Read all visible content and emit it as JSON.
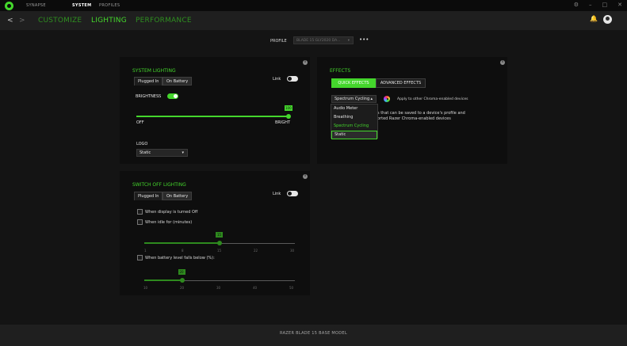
{
  "titlebar": {
    "tabs": [
      "SYNAPSE",
      "SYSTEM",
      "PROFILES"
    ],
    "active_tab": "SYSTEM"
  },
  "subnav": {
    "back": "<",
    "forward": ">",
    "tabs": [
      "CUSTOMIZE",
      "LIGHTING",
      "PERFORMANCE"
    ],
    "active_tab": "LIGHTING"
  },
  "profile": {
    "label": "PROFILE",
    "value": "BLADE 15 GLY2020 DA...",
    "more": "•••"
  },
  "system_lighting": {
    "title": "SYSTEM LIGHTING",
    "tabs": [
      "Plugged In",
      "On Battery"
    ],
    "link_label": "Link",
    "link_on": false,
    "brightness_label": "BRIGHTNESS",
    "brightness_toggle_on": true,
    "brightness_value": "100",
    "brightness_fraction": 1.0,
    "min_label": "OFF",
    "max_label": "BRIGHT",
    "logo_label": "LOGO",
    "logo_value": "Static"
  },
  "switch_off_lighting": {
    "title": "SWITCH OFF LIGHTING",
    "tabs": [
      "Plugged In",
      "On Battery"
    ],
    "link_label": "Link",
    "link_on": false,
    "opt_display_off": "When display is turned Off",
    "opt_idle": "When idle for (minutes)",
    "idle_value": "15",
    "idle_fraction": 0.5,
    "idle_ticks": [
      "1",
      "8",
      "15",
      "22",
      "30"
    ],
    "opt_battery": "When battery level falls below (%):",
    "battery_value": "20",
    "battery_fraction": 0.25,
    "battery_ticks": [
      "10",
      "20",
      "30",
      "40",
      "50"
    ]
  },
  "effects": {
    "title": "EFFECTS",
    "tabs": [
      "QUICK EFFECTS",
      "ADVANCED EFFECTS"
    ],
    "selected": "Spectrum Cycling",
    "apply_label": "Apply to other Chroma-enabled devices",
    "options": [
      "Audio Meter",
      "Breathing",
      "Spectrum Cycling",
      "Static"
    ],
    "highlighted": "Spectrum Cycling",
    "hovered": "Static",
    "desc_line1": "s that can be saved to a device's profile and",
    "desc_line2": "orted Razer Chroma-enabled devices"
  },
  "footer": {
    "device": "RAZER BLADE 15 BASE MODEL"
  },
  "colors": {
    "accent": "#44d62c",
    "background": "#141414",
    "panel": "#0e0e0e"
  }
}
